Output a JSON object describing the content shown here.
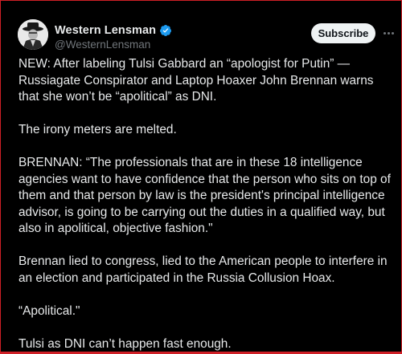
{
  "author": {
    "display_name": "Western Lensman",
    "handle": "@WesternLensman",
    "verified": true,
    "avatar_icon": "avatar-photo"
  },
  "actions": {
    "subscribe_label": "Subscribe",
    "more_icon": "more-dots-icon"
  },
  "tweet": {
    "paragraphs": [
      "NEW: After labeling Tulsi Gabbard an “apologist for Putin” — Russiagate Conspirator and Laptop Hoaxer John Brennan warns that she won’t be “apolitical” as DNI.",
      "The irony meters are melted.",
      "BRENNAN: “The professionals that are in these 18 intelligence agencies want to have confidence that the person who sits on top of them and that person by law is the president's principal intelligence advisor, is going to be carrying out the duties in a qualified way, but also in apolitical, objective fashion.\"",
      "Brennan lied to congress, lied to the American people to interfere in an election and participated in the Russia Collusion Hoax.",
      "“Apolitical.\"",
      "Tulsi as DNI can’t happen fast enough."
    ]
  },
  "colors": {
    "background": "#000000",
    "text": "#e7e9ea",
    "muted": "#71767b",
    "verified_blue": "#1d9bf0",
    "button_bg": "#eff3f4",
    "frame_red": "#cf2027"
  }
}
